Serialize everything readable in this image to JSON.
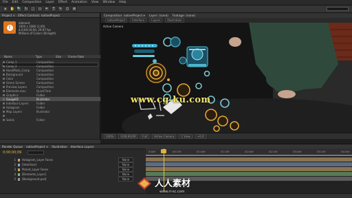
{
  "menubar": {
    "items": [
      "File",
      "Edit",
      "Composition",
      "Layer",
      "Effect",
      "Animation",
      "View",
      "Window",
      "Help"
    ]
  },
  "toolbar": {
    "tools": [
      "▸",
      "✋",
      "🔍",
      "↻",
      "⬚",
      "▭",
      "✒",
      "T",
      "✎",
      "⬡",
      "⊕",
      "✋"
    ],
    "search_placeholder": "Search Help"
  },
  "project": {
    "tabs": [
      "Project ×",
      "Effect Controls: nativeProject"
    ],
    "item_name": "element",
    "item_meta": [
      "1920 x 1080 (1.00)",
      "Δ 0;00;10;00, 29.97 fps",
      "Millions of Colors (Straight)"
    ],
    "columns": [
      "Name",
      "Type",
      "Size",
      "Frame Rate"
    ],
    "rows": [
      {
        "name": "Comp 1",
        "type": "Composition",
        "size": "",
        "sel": false
      },
      {
        "name": "Comp 2",
        "type": "Composition",
        "size": "",
        "sel": false
      },
      {
        "name": "HandPlate_Comp",
        "type": "Composition",
        "size": "",
        "sel": false
      },
      {
        "name": "Background",
        "type": "Composition",
        "size": "",
        "sel": false
      },
      {
        "name": "Color",
        "type": "Composition",
        "size": "",
        "sel": false
      },
      {
        "name": "Green Screen",
        "type": "Composition",
        "size": "",
        "sel": false
      },
      {
        "name": "Preview Layers",
        "type": "Composition",
        "size": "",
        "sel": false
      },
      {
        "name": "Elements.mov",
        "type": "QuickTime",
        "size": "",
        "sel": false
      },
      {
        "name": "Graphics",
        "type": "Folder",
        "size": "",
        "sel": false
      },
      {
        "name": "Gauge01",
        "type": "Illustrator",
        "size": "",
        "sel": true
      },
      {
        "name": "Interface Layers",
        "type": "Folder",
        "size": "",
        "sel": false
      },
      {
        "name": "Hologram",
        "type": "Folder",
        "size": "",
        "sel": false
      },
      {
        "name": "Map Layers",
        "type": "Illustrator",
        "size": "",
        "sel": false
      },
      {
        "name": "",
        "type": "",
        "size": "",
        "sel": false
      },
      {
        "name": "Solids",
        "type": "Folder",
        "size": "",
        "sel": false
      }
    ]
  },
  "composition": {
    "tabs": [
      "Composition: nativeProject ▾",
      "Layer: (none)",
      "Footage: (none)"
    ],
    "crumbs": [
      "nativeProject",
      "Interface",
      "Layers",
      "Illustration"
    ],
    "viewer_label": "Active Camera",
    "footer": [
      "100%",
      "0;00;00;09",
      "Full",
      "Active Camera",
      "1 View",
      "+0.0"
    ]
  },
  "watermark_top": "www.cg-ku.com",
  "timeline": {
    "tabs": [
      "Render Queue",
      "nativeProject ×",
      "Illustration",
      "Interface Layers"
    ],
    "current_time": "0;00;00;09",
    "ruler": [
      "0:00f",
      "00:15f",
      "01:00f",
      "01:15f",
      "02:00f",
      "02:15f",
      "03:00f",
      "03:15f",
      "04:00f"
    ],
    "layers": [
      {
        "num": "1",
        "name": "Hologram_Layer Faces",
        "mode": "None",
        "color": "#c5a25b"
      },
      {
        "num": "2",
        "name": "[Interface]",
        "mode": "None",
        "color": "#8e9fc4"
      },
      {
        "num": "3",
        "name": "Planet_Layer Faces",
        "mode": "None",
        "color": "#c5a25b"
      },
      {
        "num": "4",
        "name": "[Elements_Layer]",
        "mode": "None",
        "color": "#7fb37a"
      },
      {
        "num": "5",
        "name": "[Background.psd]",
        "mode": "None",
        "color": "#999999"
      }
    ]
  },
  "watermark_bottom": {
    "cn": "人人素材",
    "url": "www.rr-sc.com"
  },
  "colors": {
    "accent": "#e0751d",
    "playhead": "#e0c040",
    "watermark": "#f2e36a"
  }
}
